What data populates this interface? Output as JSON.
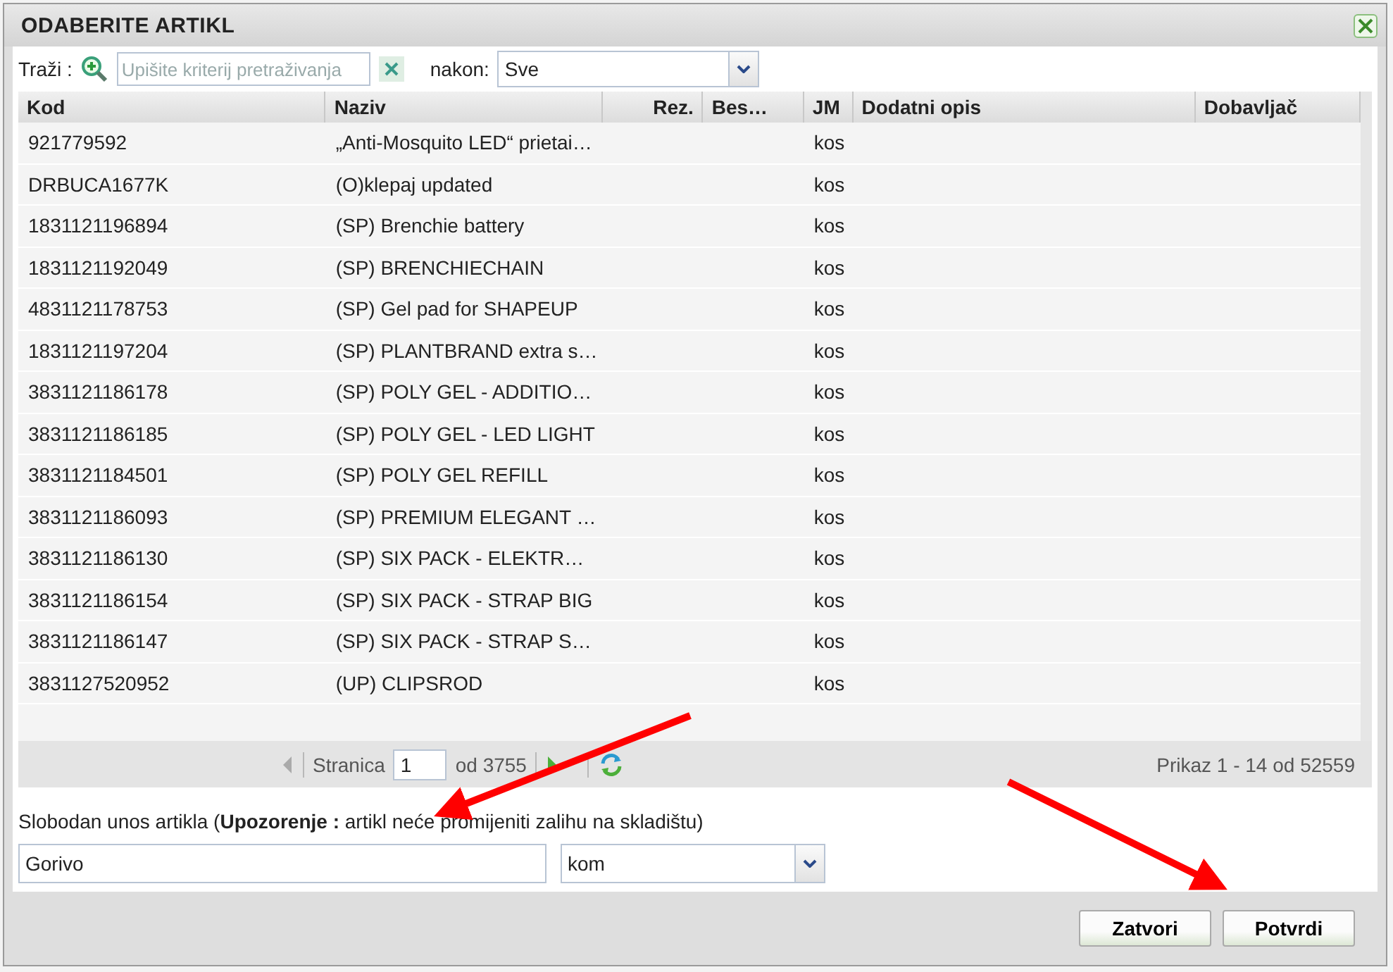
{
  "window": {
    "title": "ODABERITE ARTIKL"
  },
  "search": {
    "label": "Traži :",
    "placeholder": "Upišite kriterij pretraživanja",
    "after_label": "nakon:",
    "after_value": "Sve"
  },
  "table": {
    "columns": [
      "Kod",
      "Naziv",
      "Rez.",
      "Bes…",
      "JM",
      "Dodatni opis",
      "Dobavljač"
    ],
    "rows": [
      [
        "921779592",
        "„Anti-Mosquito LED“ prietai…",
        "",
        "",
        "kos",
        "",
        ""
      ],
      [
        "DRBUCA1677K",
        "(O)klepaj updated",
        "",
        "",
        "kos",
        "",
        ""
      ],
      [
        "1831121196894",
        "(SP) Brenchie battery",
        "",
        "",
        "kos",
        "",
        ""
      ],
      [
        "1831121192049",
        "(SP) BRENCHIECHAIN",
        "",
        "",
        "kos",
        "",
        ""
      ],
      [
        "4831121178753",
        "(SP) Gel pad for SHAPEUP",
        "",
        "",
        "kos",
        "",
        ""
      ],
      [
        "1831121197204",
        "(SP) PLANTBRAND extra s…",
        "",
        "",
        "kos",
        "",
        ""
      ],
      [
        "3831121186178",
        "(SP) POLY GEL - ADDITIO…",
        "",
        "",
        "kos",
        "",
        ""
      ],
      [
        "3831121186185",
        "(SP) POLY GEL - LED LIGHT",
        "",
        "",
        "kos",
        "",
        ""
      ],
      [
        "3831121184501",
        "(SP) POLY GEL REFILL",
        "",
        "",
        "kos",
        "",
        ""
      ],
      [
        "3831121186093",
        "(SP) PREMIUM ELEGANT …",
        "",
        "",
        "kos",
        "",
        ""
      ],
      [
        "3831121186130",
        "(SP) SIX PACK - ELEKTR…",
        "",
        "",
        "kos",
        "",
        ""
      ],
      [
        "3831121186154",
        "(SP) SIX PACK - STRAP BIG",
        "",
        "",
        "kos",
        "",
        ""
      ],
      [
        "3831121186147",
        "(SP) SIX PACK - STRAP S…",
        "",
        "",
        "kos",
        "",
        ""
      ],
      [
        "3831127520952",
        "(UP) CLIPSROD",
        "",
        "",
        "kos",
        "",
        ""
      ]
    ]
  },
  "pager": {
    "page_label": "Stranica",
    "page": "1",
    "of_pages": "od 3755",
    "summary": "Prikaz 1 - 14 od 52559"
  },
  "free_entry": {
    "label": "Slobodan unos artikla (**Upozorenje :** artikl neće promijeniti zalihu na skladištu)",
    "name_value": "Gorivo",
    "unit_value": "kom"
  },
  "buttons": [
    "Zatvori",
    "Potvrdi"
  ]
}
